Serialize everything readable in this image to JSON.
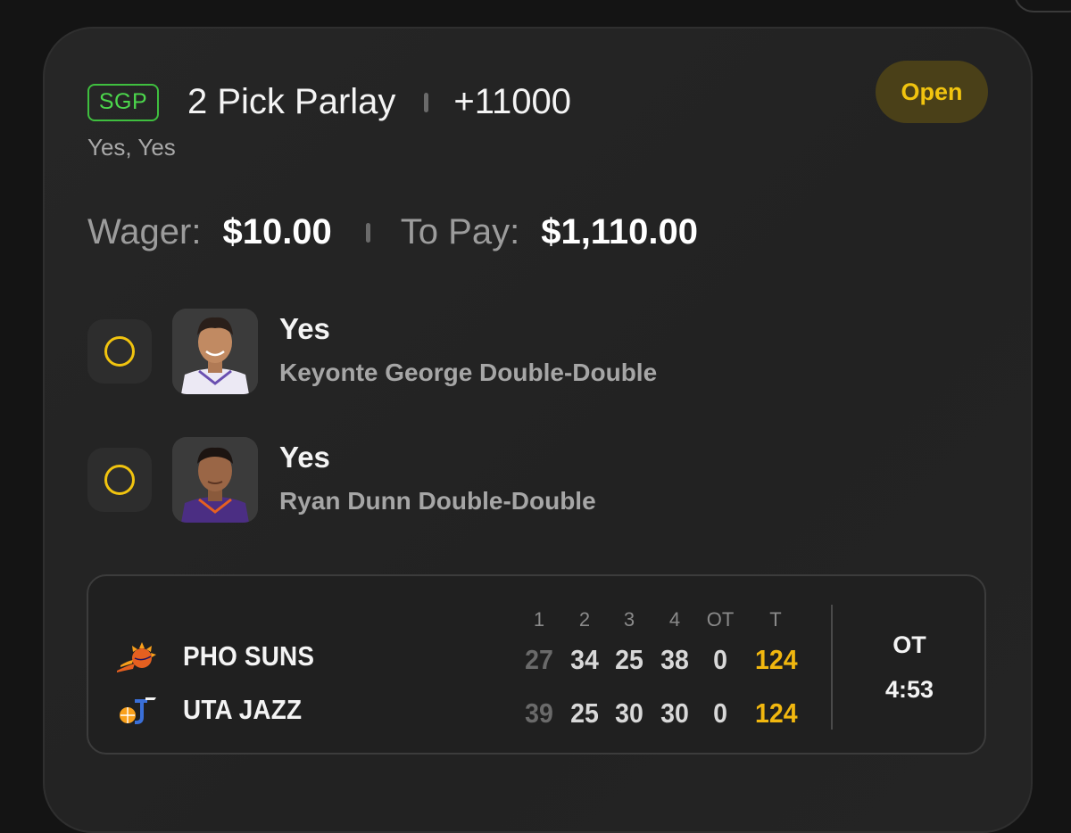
{
  "bet": {
    "badge": "SGP",
    "title": "2 Pick Parlay",
    "odds": "+11000",
    "subtitle": "Yes, Yes",
    "status": "Open",
    "wager_label": "Wager:",
    "wager_value": "$10.00",
    "payout_label": "To Pay:",
    "payout_value": "$1,110.00"
  },
  "legs": [
    {
      "pick": "Yes",
      "description": "Keyonte George Double-Double",
      "avatar_icon": "player-headshot-icon"
    },
    {
      "pick": "Yes",
      "description": "Ryan Dunn Double-Double",
      "avatar_icon": "player-headshot-icon"
    }
  ],
  "scoreboard": {
    "headers": [
      "1",
      "2",
      "3",
      "4",
      "OT",
      "T"
    ],
    "teams": [
      {
        "name": "PHO SUNS",
        "logo_icon": "suns-logo-icon",
        "scores": [
          "27",
          "34",
          "25",
          "38",
          "0",
          "124"
        ]
      },
      {
        "name": "UTA JAZZ",
        "logo_icon": "jazz-logo-icon",
        "scores": [
          "39",
          "25",
          "30",
          "30",
          "0",
          "124"
        ]
      }
    ],
    "period": "OT",
    "clock": "4:53"
  },
  "colors": {
    "accent_yellow": "#f1c40f",
    "sgp_green": "#4cd64c",
    "background": "#141414",
    "card": "#242424"
  }
}
